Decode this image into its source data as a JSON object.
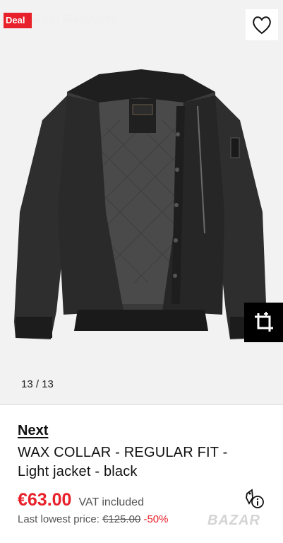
{
  "gallery": {
    "deal_badge": "Deal",
    "watermark": "Emil Georgiev",
    "counter": "13 / 13"
  },
  "product": {
    "brand": "Next",
    "title": "WAX COLLAR - REGULAR FIT - Light jacket - black",
    "price": "€63.00",
    "vat": "VAT included",
    "lowest_label": "Last lowest price:",
    "lowest_old": "€125.00",
    "discount": "-50%"
  },
  "overlay": {
    "site_watermark": "BAZAR"
  },
  "colors": {
    "accent": "#e8202a",
    "background": "#f2f2f2",
    "jacket": "#2b2b2b"
  },
  "icons": [
    "heart-icon",
    "crop-icon",
    "price-tag-info-icon"
  ]
}
